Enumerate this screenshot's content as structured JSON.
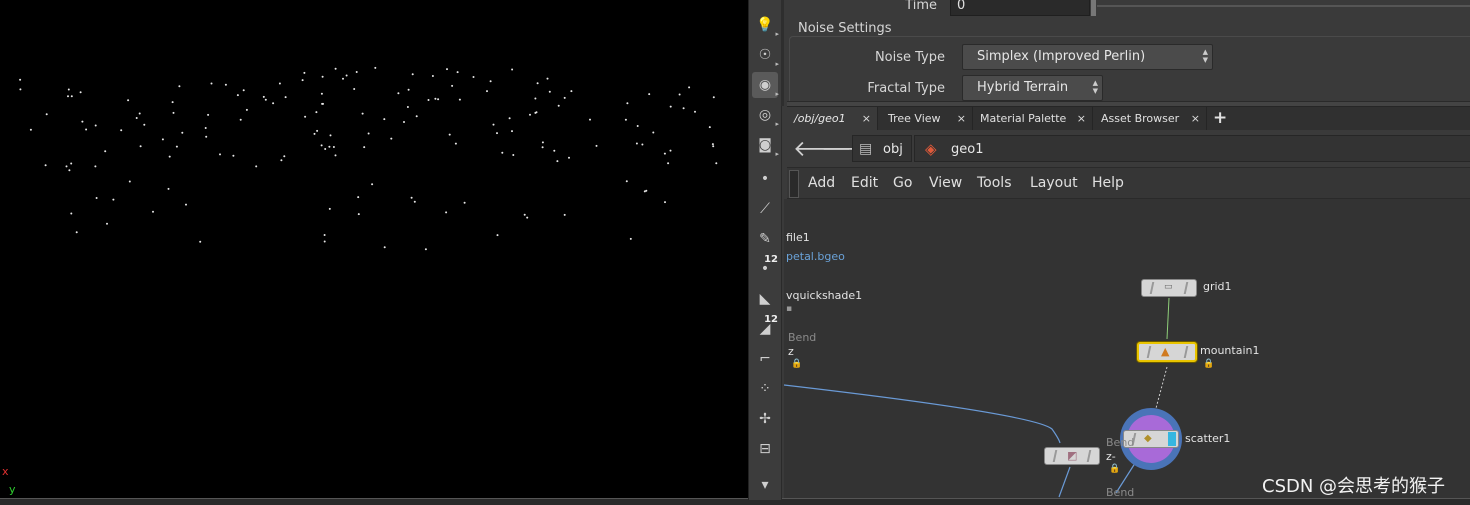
{
  "viewport": {
    "axis_x_label": "x",
    "axis_y_label": "y"
  },
  "shelf": {
    "tools": [
      {
        "icon": "lightbulb-icon",
        "glyph": "💡"
      },
      {
        "icon": "spotlight-icon",
        "glyph": "☉"
      },
      {
        "icon": "camera-lens-icon",
        "glyph": "◉"
      },
      {
        "icon": "view-eye-icon",
        "glyph": "◎"
      },
      {
        "icon": "camera-icon",
        "glyph": "◙"
      },
      {
        "icon": "point-icon",
        "glyph": "•"
      },
      {
        "icon": "brush-icon",
        "glyph": "⟋"
      },
      {
        "icon": "pen-icon",
        "glyph": "✎"
      },
      {
        "icon": "point-number-icon",
        "glyph": "•",
        "number": "12"
      },
      {
        "icon": "fill-icon",
        "glyph": "◣"
      },
      {
        "icon": "prim-number-icon",
        "glyph": "◢",
        "number": "12"
      },
      {
        "icon": "curve-icon",
        "glyph": "⌐"
      },
      {
        "icon": "grid-points-icon",
        "glyph": "⁘"
      },
      {
        "icon": "handle-icon",
        "glyph": "✢"
      },
      {
        "icon": "window-icon",
        "glyph": "⊟"
      },
      {
        "icon": "expand-down-icon",
        "glyph": "▾"
      }
    ]
  },
  "params": {
    "time_label": "Time",
    "time_value": "0",
    "group_title": "Noise Settings",
    "noise_type_label": "Noise Type",
    "noise_type_value": "Simplex (Improved Perlin)",
    "fractal_type_label": "Fractal Type",
    "fractal_type_value": "Hybrid Terrain"
  },
  "tabs": [
    {
      "label": "/obj/geo1",
      "close": "×"
    },
    {
      "label": "Tree View",
      "close": "×"
    },
    {
      "label": "Material Palette",
      "close": "×"
    },
    {
      "label": "Asset Browser",
      "close": "×"
    },
    {
      "label": "+"
    }
  ],
  "path": {
    "back_glyph": "🡐",
    "forward_glyph": "🡒",
    "crumb_obj": "obj",
    "crumb_geo": "geo1"
  },
  "menu": [
    "Add",
    "Edit",
    "Go",
    "View",
    "Tools",
    "Layout",
    "Help"
  ],
  "network": {
    "file1": "file1",
    "file1_path": "petal.bgeo",
    "vquickshade": "vquickshade1",
    "bend_label": "Bend",
    "bend_z": "z",
    "grid1": "grid1",
    "mountain1": "mountain1",
    "scatter1": "scatter1",
    "bend2_label": "Bend",
    "bend2_z": "z-",
    "bend3_label": "Bend"
  },
  "watermark": "CSDN @会思考的猴子"
}
